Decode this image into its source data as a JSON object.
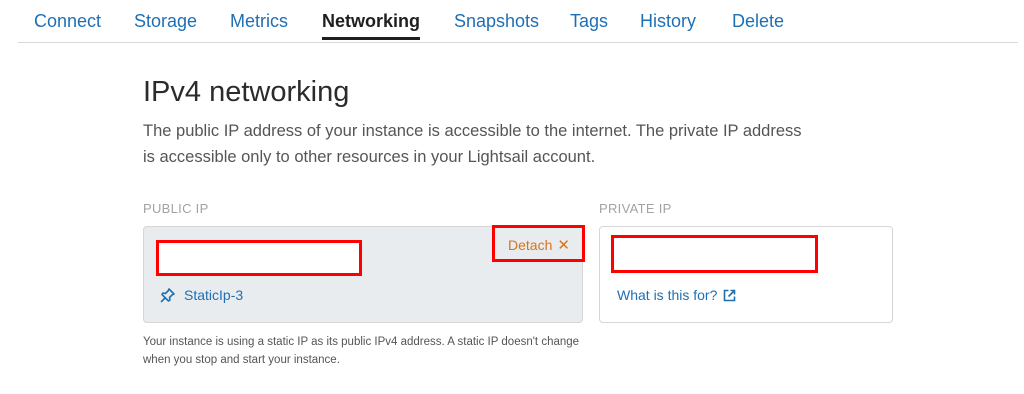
{
  "tabs": [
    {
      "label": "Connect"
    },
    {
      "label": "Storage"
    },
    {
      "label": "Metrics"
    },
    {
      "label": "Networking",
      "active": true
    },
    {
      "label": "Snapshots"
    },
    {
      "label": "Tags"
    },
    {
      "label": "History"
    },
    {
      "label": "Delete"
    }
  ],
  "section": {
    "title": "IPv4 networking",
    "description": "The public IP address of your instance is accessible to the internet. The private IP address is accessible only to other resources in your Lightsail account."
  },
  "public_ip": {
    "label": "PUBLIC IP",
    "value": "",
    "detach_label": "Detach",
    "static_ip_name": "StaticIp-3",
    "footnote": "Your instance is using a static IP as its public IPv4 address. A static IP doesn't change when you stop and start your instance."
  },
  "private_ip": {
    "label": "PRIVATE IP",
    "value": "",
    "help_link": "What is this for?"
  },
  "colors": {
    "link": "#1f6fb5",
    "accent_orange": "#d8751b",
    "redaction": "#ff0000",
    "public_card_bg": "#e9ecee"
  },
  "icons": {
    "static_ip": "pin-icon",
    "detach": "close-x-icon",
    "external_link": "external-link-icon"
  }
}
